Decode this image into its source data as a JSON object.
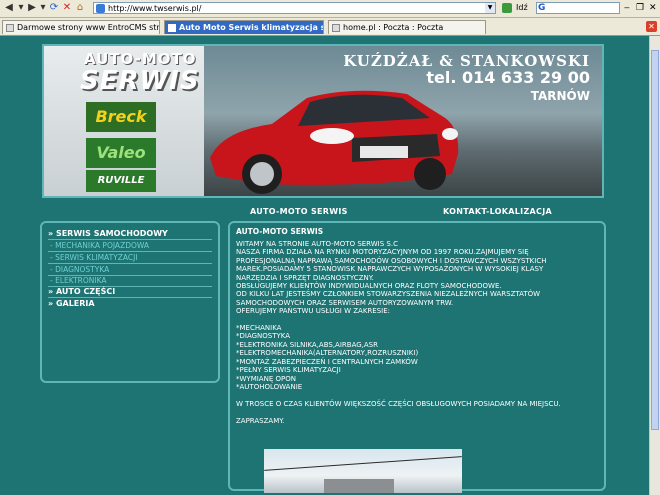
{
  "browser": {
    "url": "http://www.twserwis.pl/",
    "go_label": "Idź",
    "search_logo": "G",
    "tabs": [
      {
        "label": "Darmowe strony www EntroCMS strony inter..."
      },
      {
        "label": "Auto Moto Serwis klimatyzacja samo..."
      },
      {
        "label": "home.pl : Poczta : Poczta"
      }
    ]
  },
  "banner": {
    "logo_line1": "AUTO-MOTO",
    "logo_line2": "SERWIS",
    "brands": [
      "Breck",
      "Valeo",
      "RUVILLE"
    ],
    "company": "KUŹDŻAŁ & STANKOWSKI",
    "phone": "tel. 014 633 29 00",
    "city": "TARNÓW"
  },
  "nav": {
    "left": "AUTO-MOTO SERWIS",
    "right": "KONTAKT-LOKALIZACJA"
  },
  "sidebar": {
    "items": [
      {
        "label": "» SERWIS SAMOCHODOWY"
      },
      {
        "label": "- MECHANIKA POJAZDOWA"
      },
      {
        "label": "- SERWIS KLIMATYZACJI"
      },
      {
        "label": "- DIAGNOSTYKA"
      },
      {
        "label": "- ELEKTRONIKA"
      },
      {
        "label": "» AUTO CZĘŚCI"
      },
      {
        "label": "» GALERIA"
      }
    ]
  },
  "content": {
    "title": "AUTO-MOTO SERWIS",
    "body": "WITAMY NA STRONIE AUTO-MOTO SERWIS S.C\nNASZA FIRMA DZIAŁA NA RYNKU MOTORYZACYJNYM OD 1997 ROKU.ZAJMUJEMY SIĘ\nPROFESJONALNĄ NAPRAWĄ SAMOCHODÓW OSOBOWYCH I DOSTAWCZYCH WSZYSTKICH\nMAREK.POSIADAMY 5 STANOWISK NAPRAWCZYCH WYPOSAŻONYCH W WYSOKIEJ KLASY\nNARZĘDZIA I SPRZĘT DIAGNOSTYCZNY.\nOBSŁUGUJEMY KLIENTÓW INDYWIDUALNYCH ORAZ FLOTY SAMOCHODOWE.\nOD KILKU LAT JESTEŚMY CZŁONKIEM STOWARZYSZENIA NIEZALEŻNYCH WARSZTATÓW\nSAMOCHODOWYCH ORAZ SERWISEM AUTORYZOWANYM TRW.\nOFERUJEMY PAŃSTWU USŁUGI W ZAKRESIE:\n\n*MECHANIKA\n*DIAGNOSTYKA\n*ELEKTRONIKA SILNIKA,ABS,AIRBAG,ASR\n*ELEKTROMECHANIKA(ALTERNATORY,ROZRUSZNIKI)\n*MONTAŻ ZABEZPIECZEŃ I CENTRALNYCH ZAMKÓW\n*PEŁNY SERWIS KLIMATYZACJI\n*WYMIANĘ OPON\n*AUTOHOLOWANIE\n\nW TROSCE O CZAS KLIENTÓW WIĘKSZOŚĆ CZĘŚCI OBSŁUGOWYCH POSIADAMY NA MIEJSCU.\n\nZAPRASZAMY."
  },
  "colors": {
    "page_bg": "#1e7373",
    "border": "#5fb6b6",
    "link_sub": "#6ed0d0",
    "car_red": "#c8141b"
  }
}
